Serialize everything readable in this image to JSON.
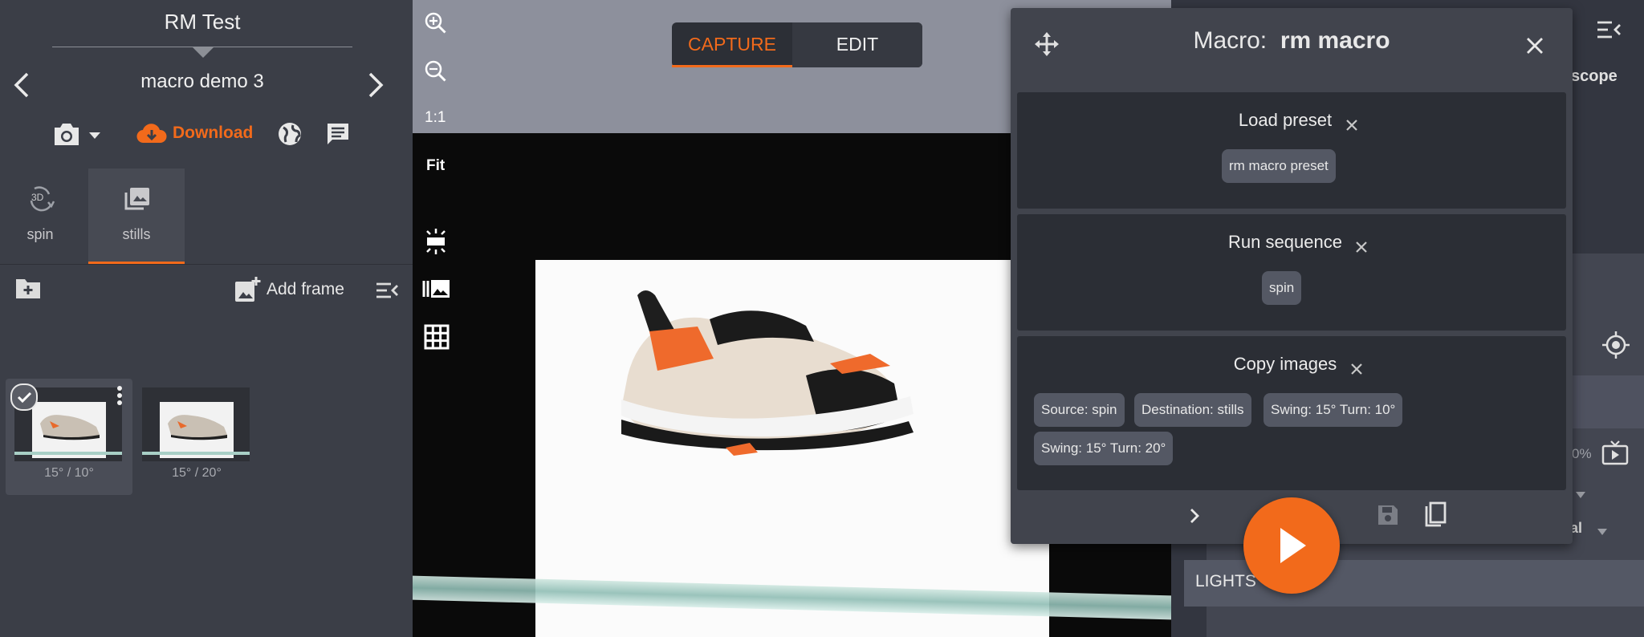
{
  "left_panel": {
    "project_title": "RM Test",
    "sequence_title": "macro demo 3",
    "download_label": "Download",
    "tabs": [
      {
        "label": "spin",
        "badge": "3D"
      },
      {
        "label": "stills"
      }
    ],
    "add_frame_label": "Add frame",
    "thumbnails": [
      {
        "caption": "15° / 10°",
        "selected": true
      },
      {
        "caption": "15° / 20°",
        "selected": false
      }
    ]
  },
  "viewer": {
    "mode_toggle": {
      "capture_label": "CAPTURE",
      "edit_label": "EDIT",
      "active": "CAPTURE"
    },
    "zoom_one_to_one": "1:1",
    "zoom_fit": "Fit"
  },
  "macro_dialog": {
    "title_prefix": "Macro:",
    "title_name": "rm macro",
    "steps": [
      {
        "title": "Load preset",
        "chips": [
          "rm macro preset"
        ]
      },
      {
        "title": "Run sequence",
        "chips": [
          "spin"
        ]
      },
      {
        "title": "Copy images",
        "chips": [
          "Source: spin",
          "Destination: stills",
          "Swing: 15°  Turn: 10°",
          "Swing: 15°  Turn: 20°"
        ]
      }
    ]
  },
  "right_panel": {
    "scope_label": "scope",
    "percent_label": "0%",
    "ual_label": "ual",
    "lights_label": "LIGHTS"
  },
  "colors": {
    "accent": "#f26a1b",
    "panel": "#3b3e47",
    "dialog": "#41444d"
  }
}
